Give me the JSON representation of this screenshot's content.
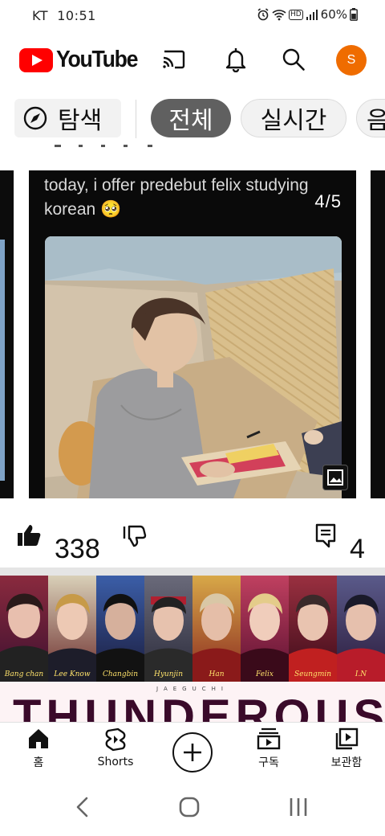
{
  "status_bar": {
    "carrier": "KT",
    "time": "10:51",
    "network_badge": "HD",
    "battery": "60%",
    "icons": [
      "alarm-icon",
      "wifi-icon",
      "signal-icon",
      "battery-icon"
    ]
  },
  "header": {
    "logo_text": "YouTube",
    "icons": [
      "cast-icon",
      "bell-icon",
      "search-icon"
    ],
    "avatar_letter": "S",
    "avatar_color": "#ef6c00"
  },
  "chips": {
    "explore_label": "탐색",
    "items": [
      {
        "label": "전체",
        "selected": true
      },
      {
        "label": "실시간",
        "selected": false
      },
      {
        "label": "음",
        "selected": false
      }
    ]
  },
  "post": {
    "caption": "today, i offer predebut felix studying korean 🥺",
    "counter": "4/5",
    "like_count": "338",
    "comment_count": "4"
  },
  "next_video": {
    "members": [
      "Bang chan",
      "Lee Know",
      "Changbin",
      "Hyunjin",
      "Han",
      "Felix",
      "Seungmin",
      "I.N"
    ],
    "credit": "JAEGUCHI",
    "title_text": "THUNDEROUS"
  },
  "bottom_nav": {
    "items": [
      {
        "label": "홈",
        "icon": "home-icon"
      },
      {
        "label": "Shorts",
        "icon": "shorts-icon"
      },
      {
        "label": "",
        "icon": "create-icon"
      },
      {
        "label": "구독",
        "icon": "subscriptions-icon"
      },
      {
        "label": "보관함",
        "icon": "library-icon"
      }
    ]
  },
  "colors": {
    "brand_red": "#ff0000",
    "chip_selected_bg": "#606060",
    "chip_bg": "#f2f2f2"
  }
}
